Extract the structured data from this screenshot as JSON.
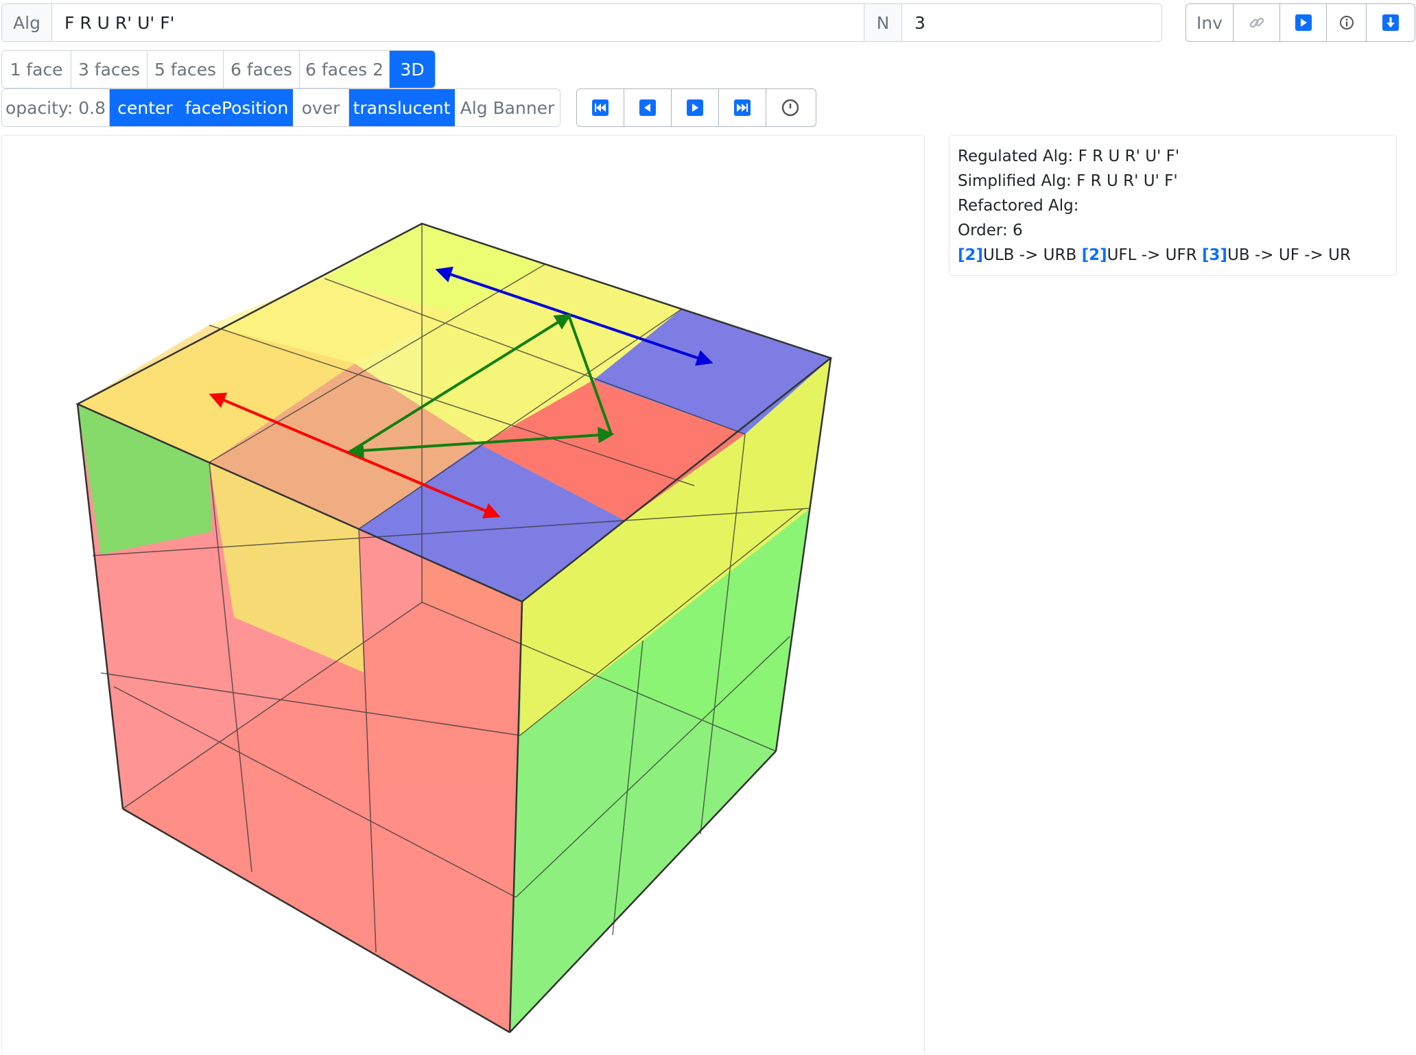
{
  "alg_bar": {
    "label": "Alg",
    "value": "F R U R' U' F'",
    "n_label": "N",
    "n_value": "3"
  },
  "right_toolbar": [
    {
      "type": "text",
      "label": "Inv",
      "name": "inverse-button"
    },
    {
      "type": "icon",
      "icon": "link-icon",
      "name": "link-button"
    },
    {
      "type": "icon",
      "icon": "play-icon",
      "name": "play-button"
    },
    {
      "type": "icon",
      "icon": "info-icon",
      "name": "info-button"
    },
    {
      "type": "icon",
      "icon": "download-icon",
      "name": "download-button"
    }
  ],
  "view_tabs": [
    {
      "label": "1 face",
      "active": false
    },
    {
      "label": "3 faces",
      "active": false
    },
    {
      "label": "5 faces",
      "active": false
    },
    {
      "label": "6 faces",
      "active": false
    },
    {
      "label": "6 faces 2",
      "active": false
    },
    {
      "label": "3D",
      "active": true
    }
  ],
  "options": [
    {
      "label": "opacity: 0.8",
      "active": false
    },
    {
      "label": "center",
      "active": true
    },
    {
      "label": "facePosition",
      "active": true
    },
    {
      "label": "over",
      "active": false
    },
    {
      "label": "translucent",
      "active": true
    },
    {
      "label": "Alg Banner",
      "active": false
    }
  ],
  "playback": [
    {
      "icon": "skip-to-start-icon",
      "name": "skip-start-button"
    },
    {
      "icon": "step-back-icon",
      "name": "step-back-button"
    },
    {
      "icon": "step-forward-icon",
      "name": "step-forward-button"
    },
    {
      "icon": "skip-to-end-icon",
      "name": "skip-end-button"
    },
    {
      "icon": "clock-icon",
      "name": "timer-button"
    }
  ],
  "info": {
    "regulated": "Regulated Alg: F R U R' U' F'",
    "simplified": "Simplified Alg: F R U R' U' F'",
    "refactored": "Refactored Alg:",
    "order": "Order: 6",
    "cycles": [
      {
        "count": "[2]",
        "text": "ULB -> URB"
      },
      {
        "count": "[2]",
        "text": "UFL -> UFR"
      },
      {
        "count": "[3]",
        "text": "UB -> UF -> UR"
      }
    ]
  },
  "colors": {
    "primary": "#0d6efd",
    "face_top_yellow": "#f2f24a",
    "face_front_red": "#ff6b6b",
    "face_right_green": "#5cf25c",
    "sticker_blue": "#7070f0",
    "arrow_red": "#ff0000",
    "arrow_blue": "#0000dd",
    "arrow_green": "#118011"
  }
}
